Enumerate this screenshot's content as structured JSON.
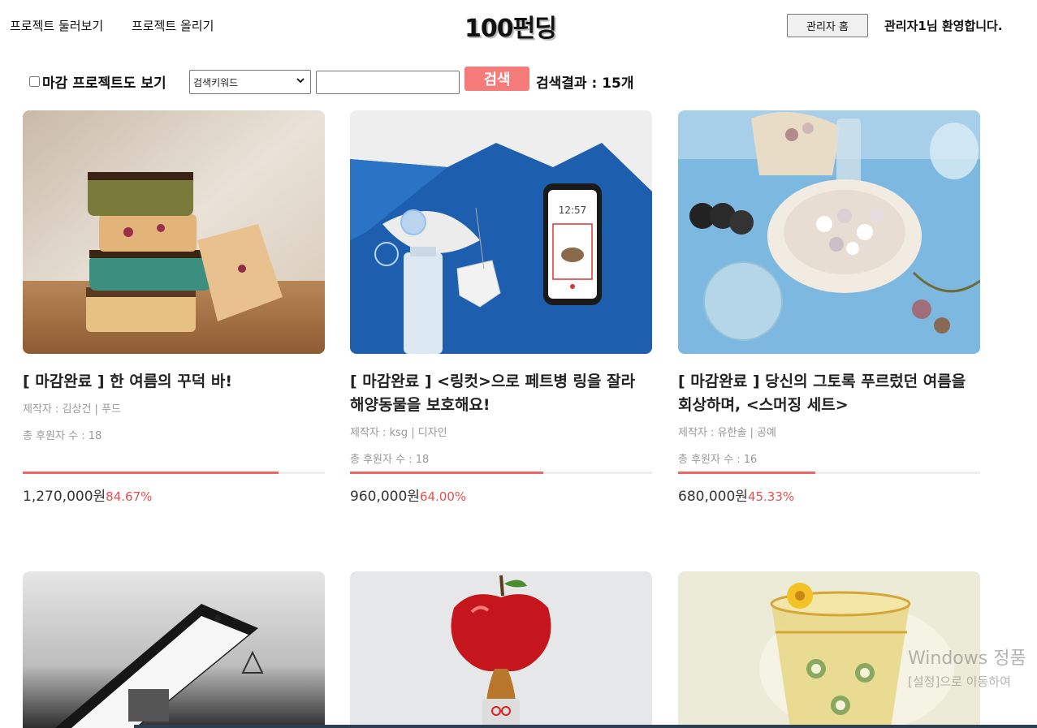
{
  "header": {
    "nav_browse": "프로젝트 둘러보기",
    "nav_upload": "프로젝트 올리기",
    "logo": "100펀딩",
    "admin_home": "관리자 홈",
    "welcome": "관리자1님 환영합니다."
  },
  "search": {
    "closed_checkbox_label": "마감 프로젝트도 보기",
    "keyword_select": "검색키워드",
    "input_value": "",
    "button": "검색",
    "result_count": "검색결과 : 15개"
  },
  "cards": [
    {
      "title": "[ 마감완료 ] 한 여름의 꾸덕 바!",
      "meta": "제작자 : 김상건 | 푸드",
      "backers": "총 후원자 수 : 18",
      "amount": "1,270,000원",
      "percent": "84.67%",
      "progress": 0.8467
    },
    {
      "title": "[ 마감완료 ] <링컷>으로 페트병 링을 잘라 해양동물을 보호해요!",
      "meta": "제작자 : ksg | 디자인",
      "backers": "총 후원자 수 : 18",
      "amount": "960,000원",
      "percent": "64.00%",
      "progress": 0.64
    },
    {
      "title": "[ 마감완료 ] 당신의 그토록 푸르렀던 여름을 회상하며, <스머징 세트>",
      "meta": "제작자 : 유한솔 | 공예",
      "backers": "총 후원자 수 : 16",
      "amount": "680,000원",
      "percent": "45.33%",
      "progress": 0.4533
    },
    {
      "title": "",
      "meta": "",
      "backers": "",
      "amount": "",
      "percent": "",
      "progress": 0
    },
    {
      "title": "",
      "meta": "",
      "backers": "",
      "amount": "",
      "percent": "",
      "progress": 0
    },
    {
      "title": "",
      "meta": "",
      "backers": "",
      "amount": "",
      "percent": "",
      "progress": 0
    }
  ],
  "phone_clock": "12:57",
  "watermark": {
    "line1": "Windows 정품",
    "line2": "[설정]으로 이동하여"
  },
  "colors": {
    "accent": "#f57b7b",
    "progress": "#f06666",
    "percent_text": "#e94f4f"
  }
}
